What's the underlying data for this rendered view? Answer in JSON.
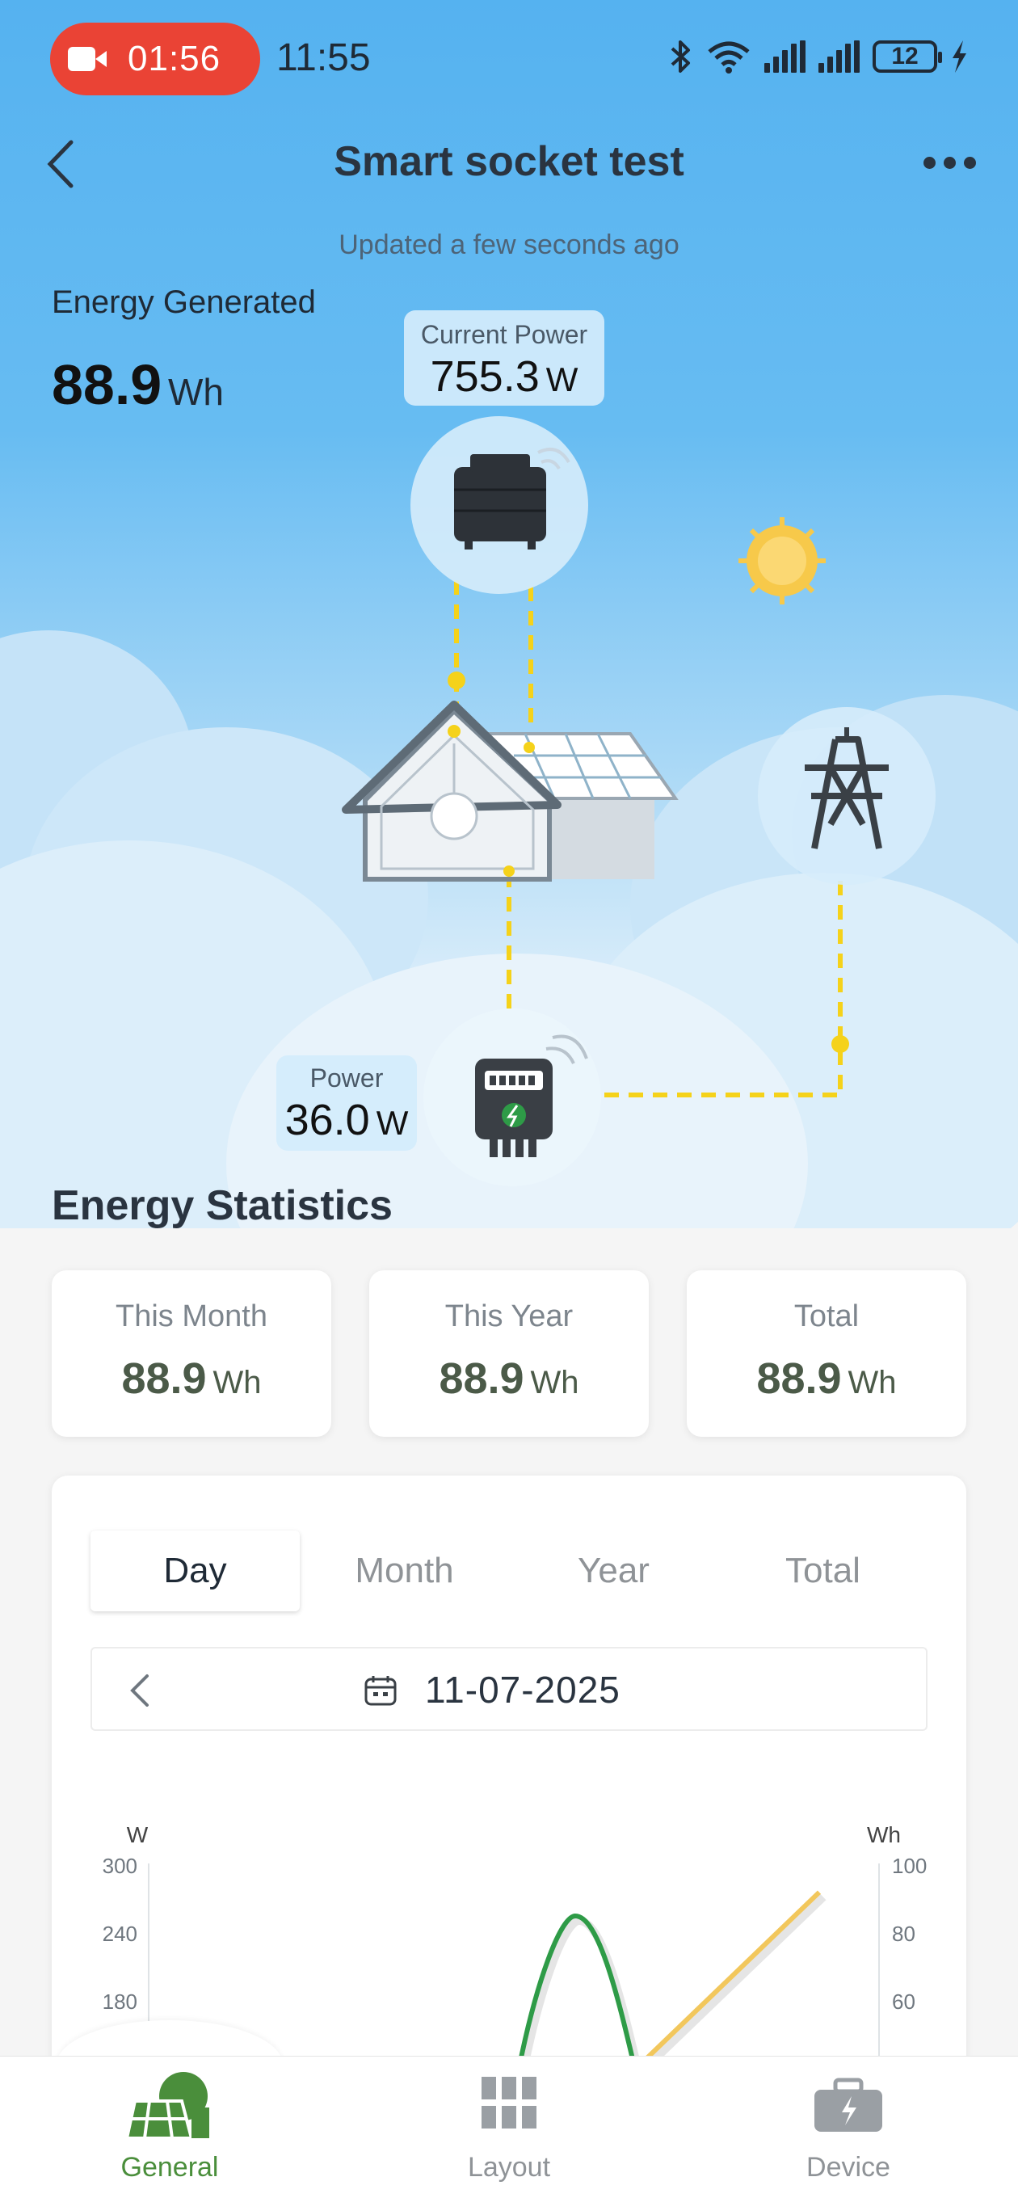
{
  "status_bar": {
    "recording_time": "01:56",
    "clock": "11:55",
    "battery": "12"
  },
  "header": {
    "title": "Smart socket test",
    "updated": "Updated a few seconds ago"
  },
  "energy_generated": {
    "label": "Energy Generated",
    "value": "88.9",
    "unit": "Wh"
  },
  "current_power": {
    "label": "Current Power",
    "value": "755.3",
    "unit": "W"
  },
  "meter_power": {
    "label": "Power",
    "value": "36.0",
    "unit": "W"
  },
  "stats": {
    "title": "Energy Statistics",
    "cards": [
      {
        "label": "This Month",
        "value": "88.9",
        "unit": "Wh"
      },
      {
        "label": "This Year",
        "value": "88.9",
        "unit": "Wh"
      },
      {
        "label": "Total",
        "value": "88.9",
        "unit": "Wh"
      }
    ]
  },
  "chart_panel": {
    "tabs": [
      "Day",
      "Month",
      "Year",
      "Total"
    ],
    "active_tab": "Day",
    "date": "11-07-2025"
  },
  "chart_data": {
    "type": "line",
    "left_axis": {
      "unit": "W",
      "ticks": [
        300,
        240,
        180
      ]
    },
    "right_axis": {
      "unit": "Wh",
      "ticks": [
        100,
        80,
        60
      ]
    },
    "series": [
      {
        "axis": "left",
        "color": "#2e9b47",
        "peak": 255
      },
      {
        "axis": "right",
        "color": "#f2c75c",
        "end": 92
      }
    ]
  },
  "colors": {
    "accent_green": "#4a8e3b",
    "flow_yellow": "#f5d21a",
    "rec_red": "#ea4335"
  },
  "bottom_nav": {
    "items": [
      {
        "label": "General",
        "icon": "solar-panel-icon"
      },
      {
        "label": "Layout",
        "icon": "grid-icon"
      },
      {
        "label": "Device",
        "icon": "toolbox-icon"
      }
    ]
  }
}
